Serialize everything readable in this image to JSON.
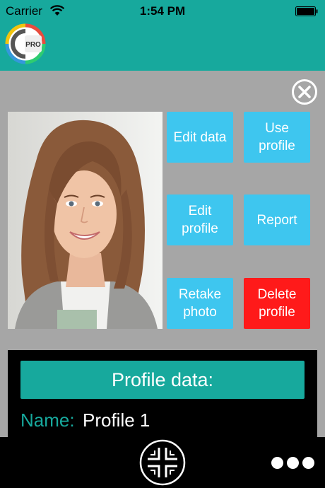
{
  "status_bar": {
    "carrier": "Carrier",
    "time": "1:54 PM"
  },
  "header": {
    "logo_text": "PRO",
    "logo_icon": "app-logo-icon"
  },
  "actions": {
    "edit_data": "Edit data",
    "use_profile": "Use\nprofile",
    "edit_profile": "Edit\nprofile",
    "report": "Report",
    "retake_photo": "Retake\nphoto",
    "delete_profile": "Delete\nprofile"
  },
  "profile": {
    "header": "Profile data:",
    "name_label": "Name:",
    "name_value": "Profile 1"
  },
  "icons": {
    "close": "close-icon",
    "scan": "scan-icon",
    "more": "more-icon"
  },
  "colors": {
    "teal": "#17a99d",
    "button_blue": "#3ec6ef",
    "danger_red": "#ff1a1a",
    "background": "#a6a6a6"
  }
}
